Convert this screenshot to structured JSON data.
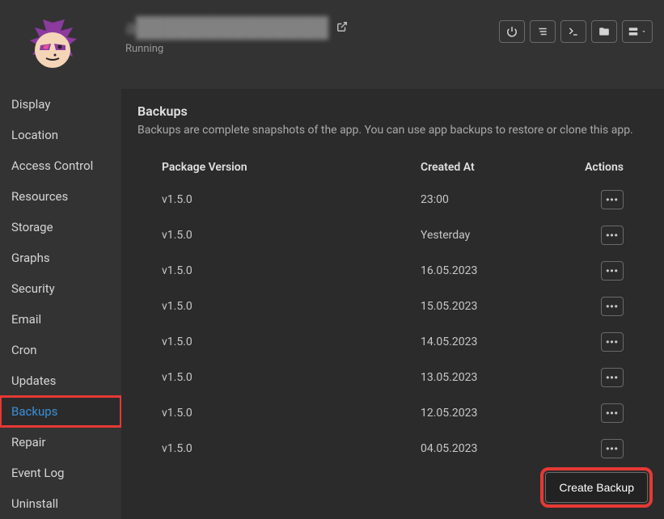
{
  "header": {
    "app_name": "a██████████████",
    "status": "Running"
  },
  "sidebar": {
    "items": [
      {
        "label": "Display"
      },
      {
        "label": "Location"
      },
      {
        "label": "Access Control"
      },
      {
        "label": "Resources"
      },
      {
        "label": "Storage"
      },
      {
        "label": "Graphs"
      },
      {
        "label": "Security"
      },
      {
        "label": "Email"
      },
      {
        "label": "Cron"
      },
      {
        "label": "Updates"
      },
      {
        "label": "Backups"
      },
      {
        "label": "Repair"
      },
      {
        "label": "Event Log"
      },
      {
        "label": "Uninstall"
      }
    ]
  },
  "content": {
    "title": "Backups",
    "description": "Backups are complete snapshots of the app. You can use app backups to restore or clone this app.",
    "columns": {
      "version": "Package Version",
      "created": "Created At",
      "actions": "Actions"
    },
    "rows": [
      {
        "version": "v1.5.0",
        "created": "23:00"
      },
      {
        "version": "v1.5.0",
        "created": "Yesterday"
      },
      {
        "version": "v1.5.0",
        "created": "16.05.2023"
      },
      {
        "version": "v1.5.0",
        "created": "15.05.2023"
      },
      {
        "version": "v1.5.0",
        "created": "14.05.2023"
      },
      {
        "version": "v1.5.0",
        "created": "13.05.2023"
      },
      {
        "version": "v1.5.0",
        "created": "12.05.2023"
      },
      {
        "version": "v1.5.0",
        "created": "04.05.2023"
      }
    ],
    "create_button": "Create Backup"
  }
}
